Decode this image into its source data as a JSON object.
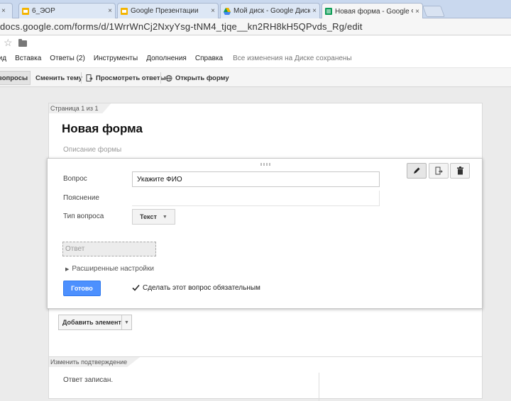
{
  "browser": {
    "tabs": [
      {
        "title": "",
        "close": "×"
      },
      {
        "title": "6_ЭОР",
        "close": "×"
      },
      {
        "title": "Google Презентаци",
        "close": "×"
      },
      {
        "title": "Google Презентации",
        "close": "×"
      },
      {
        "title": "Мой диск - Google Диск",
        "close": "×"
      },
      {
        "title": "Новая форма - Google Ф",
        "close": "×"
      }
    ],
    "url": "docs.google.com/forms/d/1WrrWnCj2NxyYsg-tNM4_tjqe__kn2RH8kH5QPvds_Rg/edit"
  },
  "docs": {
    "menu": [
      "Вид",
      "Вставка",
      "Ответы (2)",
      "Инструменты",
      "Дополнения",
      "Справка"
    ],
    "saved_status": "Все изменения на Диске сохранены"
  },
  "toolbar": {
    "questions": "вопросы",
    "change_theme": "Сменить тему",
    "view_responses": "Просмотреть ответы",
    "open_form": "Открыть форму"
  },
  "form": {
    "page_label": "Страница 1 из 1",
    "title": "Новая форма",
    "description_placeholder": "Описание формы"
  },
  "question": {
    "label_question": "Вопрос",
    "question_value": "Укажите ФИО",
    "label_help": "Пояснение",
    "label_type": "Тип вопроса",
    "type_value": "Текст",
    "answer_placeholder": "Ответ",
    "advanced": "Расширенные настройки",
    "done": "Готово",
    "required": "Сделать этот вопрос обязательным"
  },
  "add_item": "Добавить элемент",
  "confirmation": {
    "page_label": "Изменить подтверждение",
    "text": "Ответ записан."
  },
  "colors": {
    "accent_blue": "#4d90fe",
    "forms_green": "#0f9d58",
    "drive_yellow": "#f4b400",
    "slides_orange": "#f4b400"
  }
}
